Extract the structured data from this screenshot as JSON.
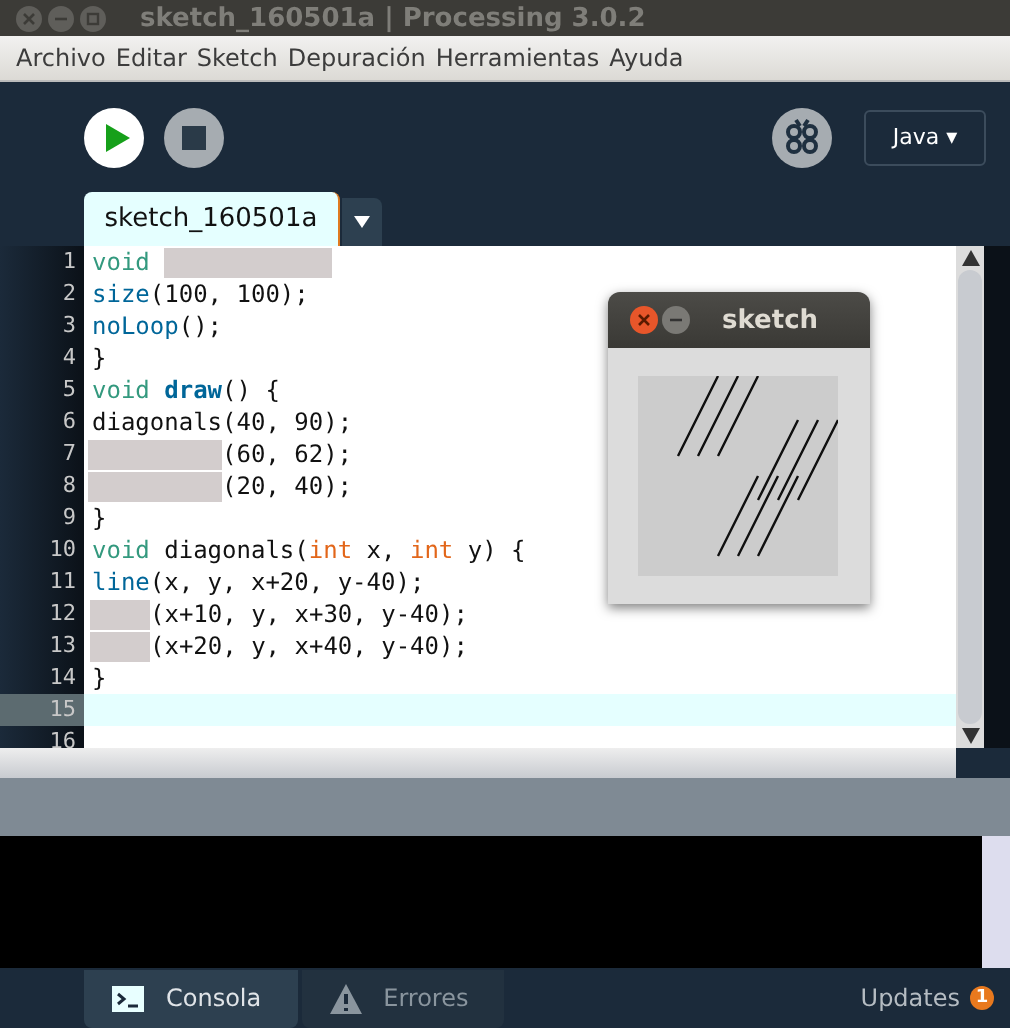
{
  "window": {
    "title": "sketch_160501a | Processing 3.0.2"
  },
  "menu": [
    "Archivo",
    "Editar",
    "Sketch",
    "Depuración",
    "Herramientas",
    "Ayuda"
  ],
  "toolbar": {
    "mode": "Java ▾"
  },
  "editor_tabs": [
    {
      "label": "sketch_160501a",
      "selected": true
    }
  ],
  "code": [
    {
      "number": "1",
      "current": false,
      "tokens": [
        {
          "kind": "keyword",
          "text": "void "
        },
        {
          "kind": "hiddenwide"
        }
      ]
    },
    {
      "number": "2",
      "current": false,
      "tokens": [
        {
          "kind": "function",
          "text": "size"
        },
        {
          "kind": "plain",
          "text": "(100, 100);"
        }
      ]
    },
    {
      "number": "3",
      "current": false,
      "tokens": [
        {
          "kind": "function",
          "text": "noLoop"
        },
        {
          "kind": "plain",
          "text": "();"
        }
      ]
    },
    {
      "number": "4",
      "current": false,
      "tokens": [
        {
          "kind": "plain",
          "text": "}"
        }
      ]
    },
    {
      "number": "5",
      "current": false,
      "tokens": [
        {
          "kind": "keyword",
          "text": "void "
        },
        {
          "kind": "bold",
          "text": "draw"
        },
        {
          "kind": "plain",
          "text": "() {"
        }
      ]
    },
    {
      "number": "6",
      "current": false,
      "tokens": [
        {
          "kind": "plain",
          "text": "diagonals(40, 90);"
        }
      ]
    },
    {
      "number": "7",
      "current": false,
      "tokens": [
        {
          "kind": "hiddenmedium"
        },
        {
          "kind": "plain",
          "text": "(60, 62);"
        }
      ]
    },
    {
      "number": "8",
      "current": false,
      "tokens": [
        {
          "kind": "hiddenmedium"
        },
        {
          "kind": "plain",
          "text": "(20, 40);"
        }
      ]
    },
    {
      "number": "9",
      "current": false,
      "tokens": [
        {
          "kind": "plain",
          "text": "}"
        }
      ]
    },
    {
      "number": "10",
      "current": false,
      "tokens": [
        {
          "kind": "keyword",
          "text": "void "
        },
        {
          "kind": "plain",
          "text": "diagonals("
        },
        {
          "kind": "type",
          "text": "int"
        },
        {
          "kind": "plain",
          "text": " x, "
        },
        {
          "kind": "type",
          "text": "int"
        },
        {
          "kind": "plain",
          "text": " y) {"
        }
      ]
    },
    {
      "number": "11",
      "current": false,
      "tokens": [
        {
          "kind": "function",
          "text": "line"
        },
        {
          "kind": "plain",
          "text": "(x, y, x+20, y-40);"
        }
      ]
    },
    {
      "number": "12",
      "current": false,
      "tokens": [
        {
          "kind": "hiddennarrow"
        },
        {
          "kind": "plain",
          "text": "(x+10, y, x+30, y-40);"
        }
      ]
    },
    {
      "number": "13",
      "current": false,
      "tokens": [
        {
          "kind": "hiddennarrow"
        },
        {
          "kind": "plain",
          "text": "(x+20, y, x+40, y-40);"
        }
      ]
    },
    {
      "number": "14",
      "current": false,
      "tokens": [
        {
          "kind": "plain",
          "text": "}"
        }
      ]
    },
    {
      "number": "15",
      "current": true
    },
    {
      "number": "16",
      "current": false
    }
  ],
  "sketch_window": {
    "title": "sketch"
  },
  "bottom_tabs": [
    {
      "label": "Consola",
      "kind": "console",
      "selected": true
    },
    {
      "label": "Errores",
      "kind": "warning",
      "selected": false
    }
  ],
  "updates": {
    "label": "Updates",
    "count": "1"
  }
}
